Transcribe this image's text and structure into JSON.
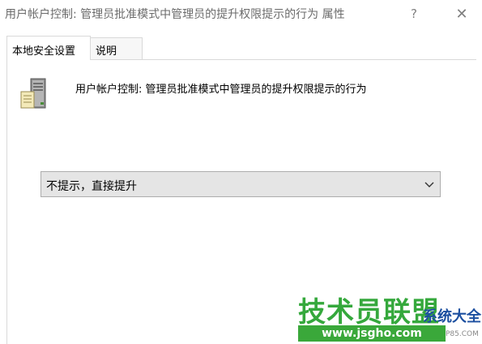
{
  "window": {
    "title": "用户帐户控制: 管理员批准模式中管理员的提升权限提示的行为 属性",
    "help_glyph": "?",
    "close_glyph": "✕"
  },
  "tabs": [
    {
      "label": "本地安全设置",
      "active": true
    },
    {
      "label": "说明",
      "active": false
    }
  ],
  "policy": {
    "icon": "server-icon",
    "label": "用户帐户控制: 管理员批准模式中管理员的提升权限提示的行为"
  },
  "setting": {
    "selected": "不提示，直接提升",
    "icon": "chevron-down-icon"
  },
  "watermark": {
    "main": "技术员联盟",
    "url": "www.jsgho.com",
    "side": "系统大全",
    "small": "P85.COM"
  },
  "colors": {
    "watermark_green": "#35a83c",
    "watermark_blue": "#1c4fa0",
    "dropdown_bg": "#e5e5e5"
  }
}
